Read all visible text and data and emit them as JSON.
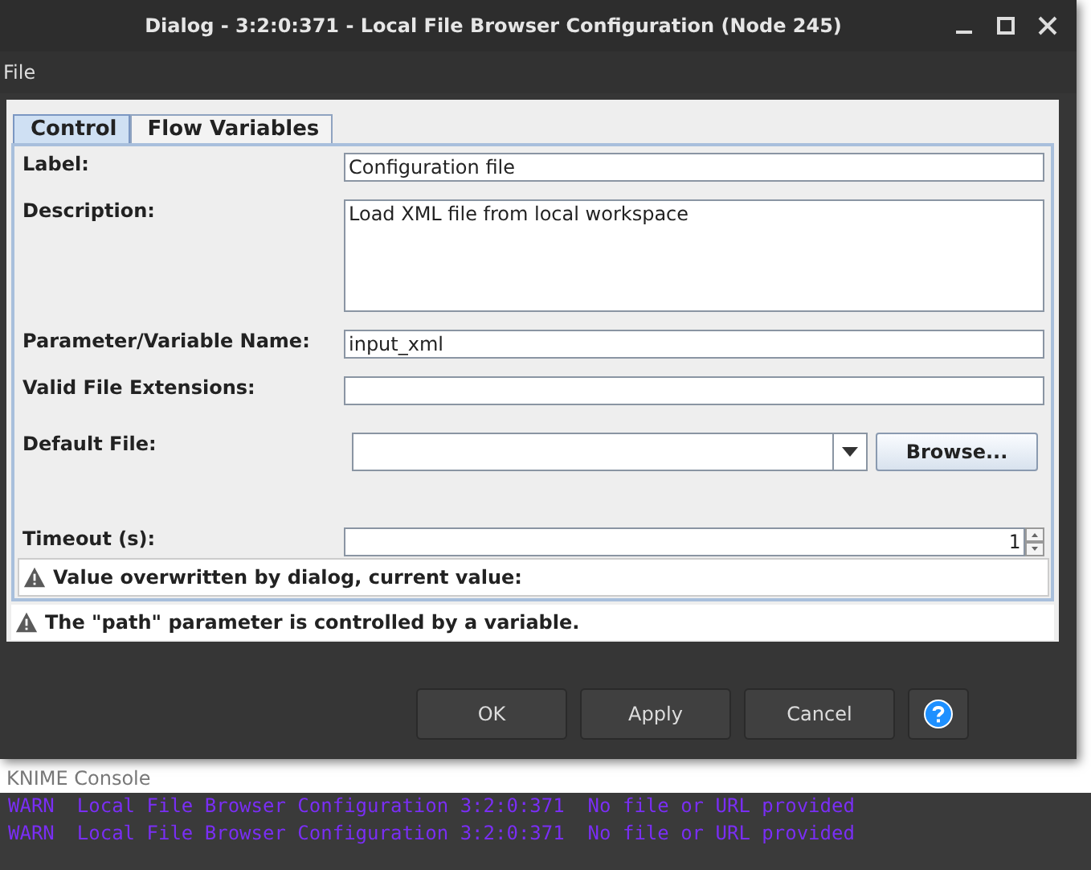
{
  "window": {
    "title": "Dialog - 3:2:0:371 - Local File Browser Configuration (Node 245)"
  },
  "menu": [
    "File"
  ],
  "tabs": [
    {
      "label": "Control",
      "selected": true
    },
    {
      "label": "Flow Variables",
      "selected": false
    }
  ],
  "fields": [
    {
      "kind": "text",
      "label": "Label:",
      "value": "Configuration file"
    },
    {
      "kind": "textarea",
      "label": "Description:",
      "value": "Load XML file from local workspace"
    },
    {
      "kind": "text",
      "label": "Parameter/Variable Name:",
      "value": "input_xml"
    },
    {
      "kind": "text",
      "label": "Valid File Extensions:"
    },
    {
      "kind": "combo",
      "label": "Default File:",
      "button": "Browse..."
    },
    {
      "kind": "spinner",
      "label": "Timeout (s):",
      "value": "1"
    }
  ],
  "inner_warning": "Value overwritten by dialog, current value:",
  "outer_warning": "The \"path\" parameter is controlled by a variable.",
  "buttons": [
    "OK",
    "Apply",
    "Cancel"
  ],
  "console": {
    "title": "KNIME Console",
    "lines": [
      {
        "level": "WARN",
        "message": "Local File Browser Configuration 3:2:0:371  No file or URL provided"
      },
      {
        "level": "WARN",
        "message": "Local File Browser Configuration 3:2:0:371  No file or URL provided"
      }
    ]
  }
}
